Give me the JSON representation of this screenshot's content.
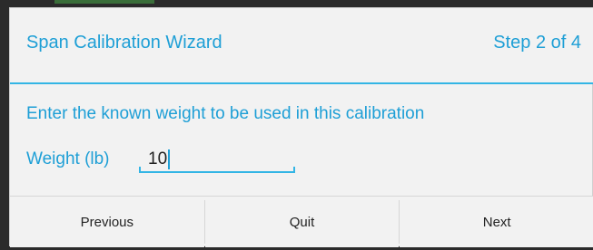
{
  "dialog": {
    "title": "Span Calibration Wizard",
    "step": "Step 2 of 4",
    "instruction": "Enter the known weight to be used in this calibration",
    "weight_label": "Weight (lb)",
    "weight_value": "10"
  },
  "buttons": {
    "previous": "Previous",
    "quit": "Quit",
    "next": "Next"
  },
  "colors": {
    "accent": "#33b5e5",
    "text_accent": "#1e9fd6"
  }
}
